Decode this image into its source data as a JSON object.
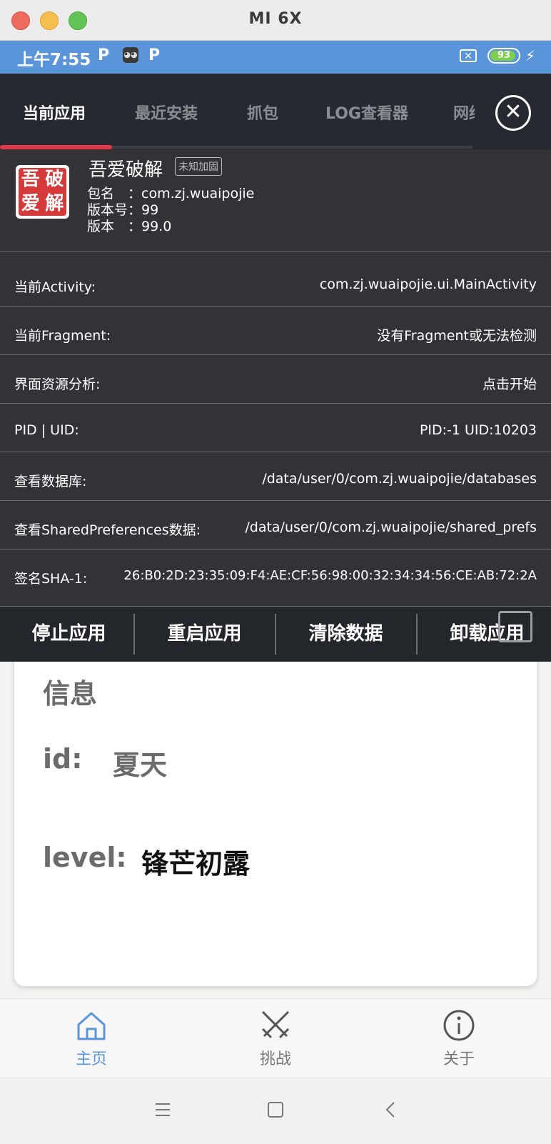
{
  "window": {
    "title": "MI 6X"
  },
  "statusbar": {
    "time": "上午7:55",
    "p1": "P",
    "p2": "P",
    "battery_level": "93",
    "battery_fraction": 0.93,
    "bolt": "⚡"
  },
  "app": {
    "info_title": "信息",
    "id_label": "id:",
    "id_value": "夏天",
    "level_label": "level:",
    "level_value": "锋芒初露"
  },
  "bottom_nav": [
    {
      "label": "主页",
      "icon": "home-icon",
      "active": true
    },
    {
      "label": "挑战",
      "icon": "crossed-swords-icon",
      "active": false
    },
    {
      "label": "关于",
      "icon": "info-icon",
      "active": false
    }
  ],
  "overlay": {
    "tabs": [
      "当前应用",
      "最近安装",
      "抓包",
      "LOG查看器",
      "网络"
    ],
    "close_icon": "close-icon",
    "icon_chars": [
      "破",
      "吾",
      "解",
      "爱"
    ],
    "app_name": "吾爱破解",
    "badge": "未知加固",
    "package": "包名　：com.zj.wuaipojie",
    "version_code": "版本号：99",
    "version": "版本　：99.0",
    "rows": [
      {
        "label": "当前Activity:",
        "value": "com.zj.wuaipojie.ui.MainActivity"
      },
      {
        "label": "当前Fragment:",
        "value": "没有Fragment或无法检测"
      },
      {
        "label": "界面资源分析:",
        "value": "点击开始"
      },
      {
        "label": "PID  |  UID:",
        "value": "PID:-1    UID:10203"
      },
      {
        "label": "查看数据库:",
        "value": "/data/user/0/com.zj.wuaipojie/databases"
      },
      {
        "label": "查看SharedPreferences数据:",
        "value": "/data/user/0/com.zj.wuaipojie/shared_prefs"
      },
      {
        "label": "签名SHA-1:",
        "value": "26:B0:2D:23:35:09:F4:AE:CF:56:98:00:32:34:34:56:CE:AB:72:2A"
      }
    ],
    "actions": [
      "停止应用",
      "重启应用",
      "清除数据",
      "卸载应用"
    ]
  },
  "colors": {
    "accent": "#e1364b",
    "statusbar": "#5b95d9",
    "nav_active": "#5b95d9",
    "nav_inactive": "#777777"
  }
}
